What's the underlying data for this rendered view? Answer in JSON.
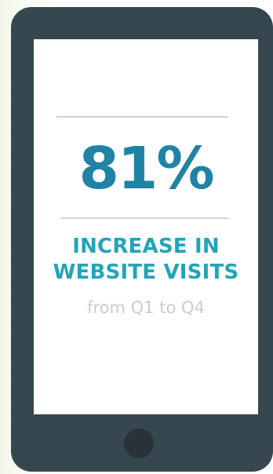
{
  "stat": {
    "value": "81%",
    "headline_line1": "INCREASE IN",
    "headline_line2": "WEBSITE VISITS",
    "subline": "from Q1 to Q4"
  },
  "colors": {
    "phone_body": "#37474f",
    "stat_value": "#1f83a6",
    "headline": "#22a4b9",
    "subline": "#c9cdcf",
    "divider": "#cfd3d4"
  },
  "icons": {
    "home_button": "circle-button"
  }
}
